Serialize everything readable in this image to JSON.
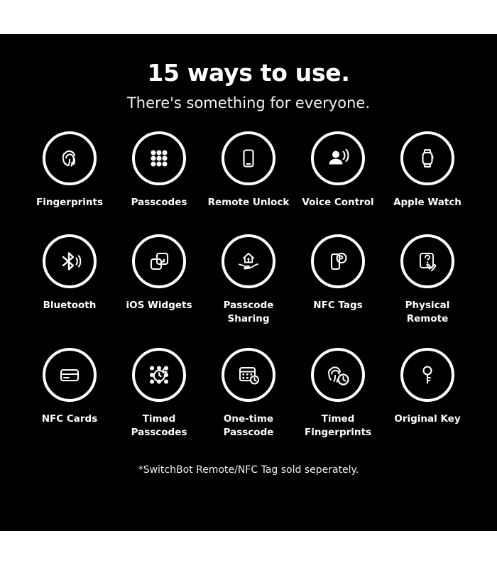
{
  "poster": {
    "background_color": "#000000",
    "text_color": "#ffffff",
    "title": "15 ways to use.",
    "subtitle": "There's something for everyone.",
    "footnote": "*SwitchBot Remote/NFC Tag sold seperately."
  },
  "rows": [
    {
      "items": [
        {
          "icon": "fingerprint-icon",
          "label": "Fingerprints"
        },
        {
          "icon": "keypad-dots-icon",
          "label": "Passcodes"
        },
        {
          "icon": "smartphone-icon",
          "label": "Remote Unlock"
        },
        {
          "icon": "voice-person-icon",
          "label": "Voice Control"
        },
        {
          "icon": "apple-watch-icon",
          "label": "Apple Watch"
        }
      ]
    },
    {
      "items": [
        {
          "icon": "bluetooth-icon",
          "label": "Bluetooth"
        },
        {
          "icon": "widgets-icon",
          "label": "iOS Widgets"
        },
        {
          "icon": "house-on-hand-icon",
          "label": "Passcode\nSharing"
        },
        {
          "icon": "nfc-tag-phone-icon",
          "label": "NFC Tags"
        },
        {
          "icon": "remote-press-icon",
          "label": "Physical\nRemote"
        }
      ]
    },
    {
      "items": [
        {
          "icon": "card-icon",
          "label": "NFC Cards"
        },
        {
          "icon": "timed-passcode-icon",
          "label": "Timed\nPasscodes"
        },
        {
          "icon": "keypad-clock-icon",
          "label": "One-time\nPasscode"
        },
        {
          "icon": "fingerprint-clock-icon",
          "label": "Timed\nFingerprints"
        },
        {
          "icon": "key-icon",
          "label": "Original Key"
        }
      ]
    }
  ]
}
